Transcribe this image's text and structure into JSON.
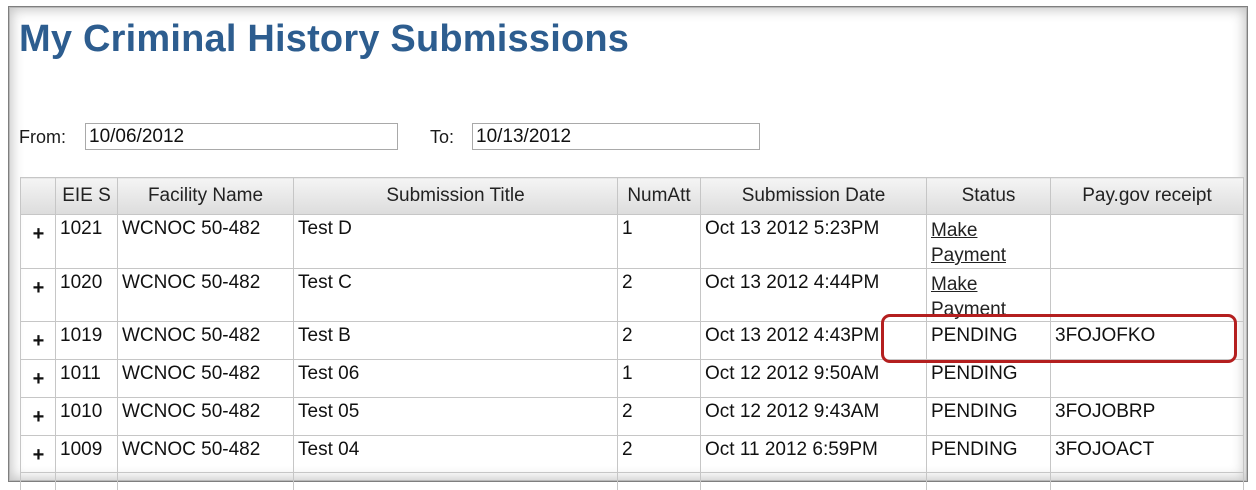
{
  "page_title": "My Criminal History Submissions",
  "filters": {
    "from_label": "From:",
    "from_value": "10/06/2012",
    "to_label": "To:",
    "to_value": "10/13/2012"
  },
  "table": {
    "columns": [
      "",
      "EIE S",
      "Facility Name",
      "Submission Title",
      "NumAtt",
      "Submission Date",
      "Status",
      "Pay.gov receipt"
    ],
    "rows": [
      {
        "expand": "+",
        "id": "1021",
        "facility": "WCNOC  50-482",
        "title": "Test D",
        "numatt": "1",
        "date": "Oct 13 2012  5:23PM",
        "status": "Make Payment",
        "status_is_link": true,
        "receipt": ""
      },
      {
        "expand": "+",
        "id": "1020",
        "facility": "WCNOC  50-482",
        "title": "Test C",
        "numatt": "2",
        "date": "Oct 13 2012  4:44PM",
        "status": "Make Payment",
        "status_is_link": true,
        "receipt": ""
      },
      {
        "expand": "+",
        "id": "1019",
        "facility": "WCNOC  50-482",
        "title": "Test B",
        "numatt": "2",
        "date": "Oct 13 2012  4:43PM",
        "status": "PENDING",
        "status_is_link": false,
        "receipt": "3FOJOFKO"
      },
      {
        "expand": "+",
        "id": "1011",
        "facility": "WCNOC  50-482",
        "title": "Test 06",
        "numatt": "1",
        "date": "Oct 12 2012  9:50AM",
        "status": "PENDING",
        "status_is_link": false,
        "receipt": ""
      },
      {
        "expand": "+",
        "id": "1010",
        "facility": "WCNOC  50-482",
        "title": "Test 05",
        "numatt": "2",
        "date": "Oct 12 2012  9:43AM",
        "status": "PENDING",
        "status_is_link": false,
        "receipt": "3FOJOBRP"
      },
      {
        "expand": "+",
        "id": "1009",
        "facility": "WCNOC  50-482",
        "title": "Test 04",
        "numatt": "2",
        "date": "Oct 11 2012  6:59PM",
        "status": "PENDING",
        "status_is_link": false,
        "receipt": "3FOJOACT"
      }
    ]
  },
  "colors": {
    "title": "#2d5d8f",
    "highlight_border": "#b41f1f"
  }
}
